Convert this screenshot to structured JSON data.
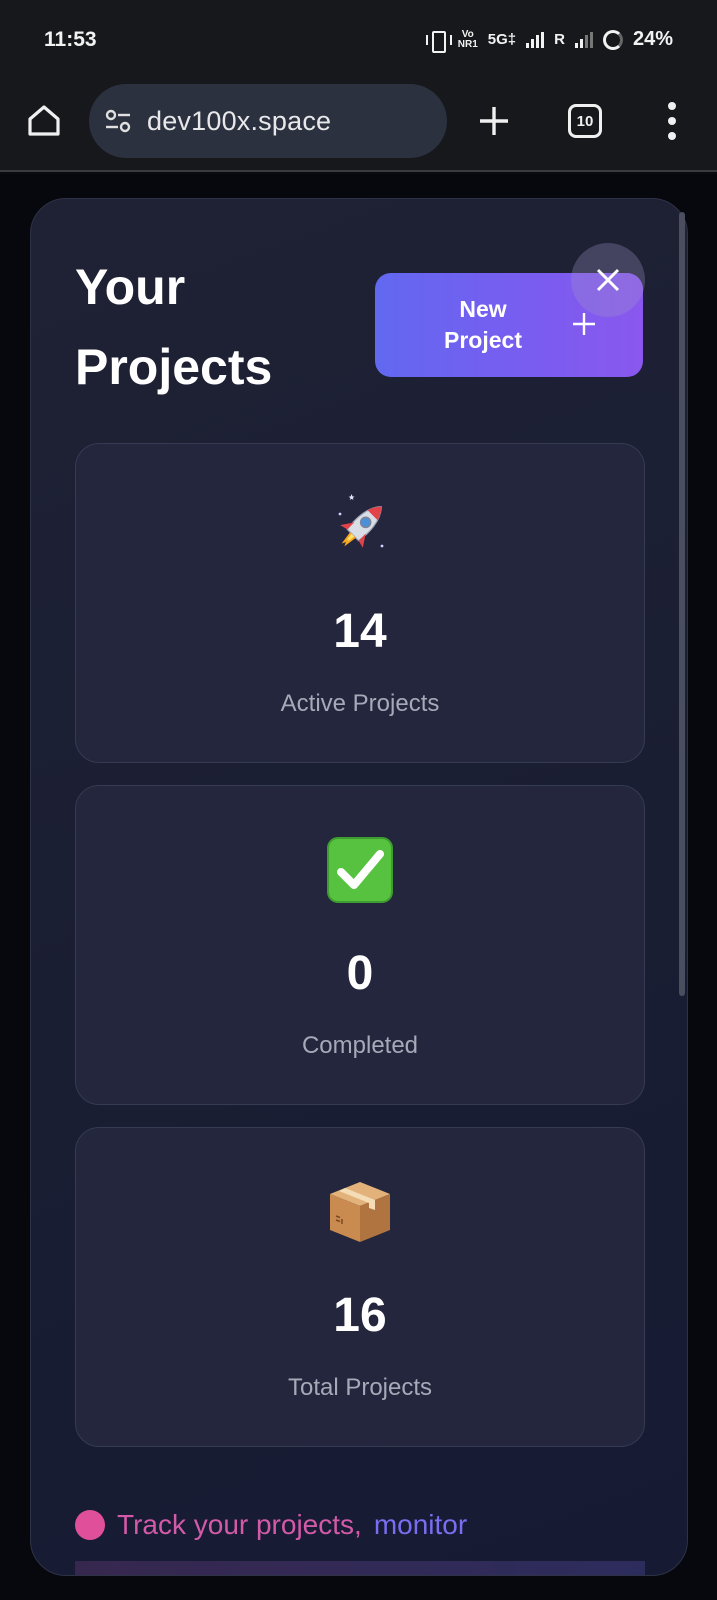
{
  "status_bar": {
    "time": "11:53",
    "volte_top": "Vo",
    "volte_bottom": "NR1",
    "network": "5G‡",
    "roaming": "R",
    "battery": "24%"
  },
  "browser": {
    "url": "dev100x.space",
    "tab_count": "10"
  },
  "page": {
    "title": "Your Projects",
    "new_project_label": "New Project",
    "stats": [
      {
        "icon": "rocket-icon",
        "value": "14",
        "label": "Active Projects"
      },
      {
        "icon": "check-mark-icon",
        "value": "0",
        "label": "Completed"
      },
      {
        "icon": "package-icon",
        "value": "16",
        "label": "Total Projects"
      }
    ],
    "footer_part1": "Track your projects,",
    "footer_part2": "monitor"
  },
  "colors": {
    "accent_gradient_start": "#6268f0",
    "accent_gradient_end": "#8a58ee",
    "card_bg": "#23263c",
    "panel_bg": "#1c1f33",
    "footer_pink": "#d25aa8",
    "footer_purple": "#7c6cf0"
  }
}
